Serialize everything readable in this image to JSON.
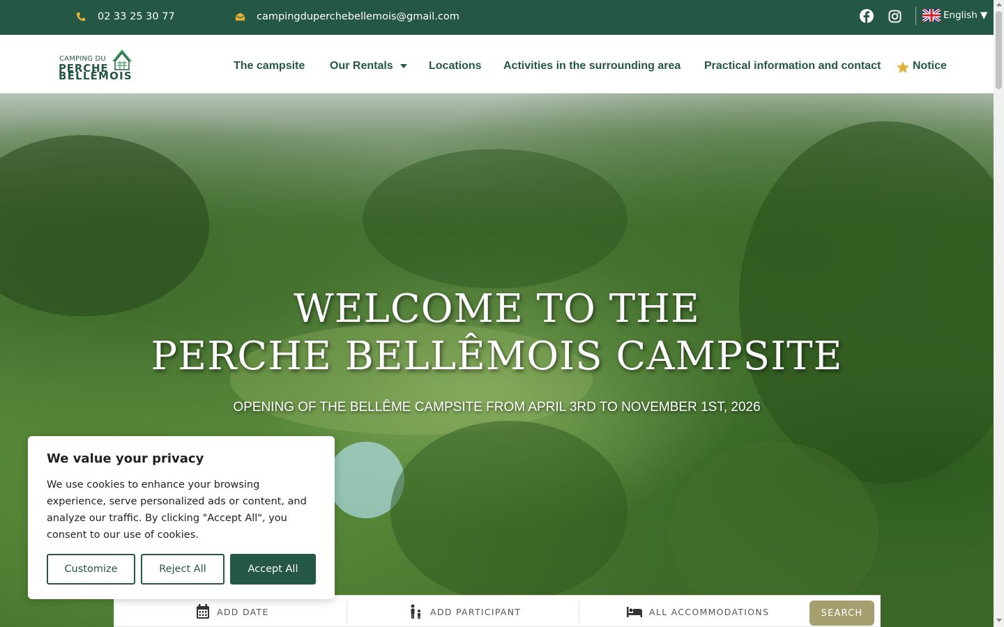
{
  "topbar": {
    "phone": "02 33 25 30 77",
    "email": "campingduperchebellemois@gmail.com",
    "phone_icon": "phone-icon",
    "email_icon": "envelope-icon",
    "social": [
      "facebook-icon",
      "instagram-icon"
    ],
    "language": "English ▼",
    "flag_icon": "uk-flag-icon"
  },
  "logo": {
    "line1": "CAMPING DU",
    "line2": "PERCHE",
    "line3": "BELLÊMOIS"
  },
  "nav": {
    "items": [
      {
        "label": "The campsite"
      },
      {
        "label": "Our Rentals"
      },
      {
        "label": "Locations"
      },
      {
        "label": "Activities in the surrounding area"
      },
      {
        "label": "Practical information and contact"
      },
      {
        "label": "Notice",
        "icon": "star-icon"
      }
    ]
  },
  "hero": {
    "title_line1": "WELCOME TO THE",
    "title_line2": "PERCHE BELLÊMOIS CAMPSITE",
    "subtitle": "OPENING OF THE BELLÊME CAMPSITE FROM APRIL 3RD TO NOVEMBER 1ST, 2026"
  },
  "booking": {
    "date_label": "ADD DATE",
    "participant_label": "ADD PARTICIPANT",
    "accommodation_label": "ALL ACCOMMODATIONS",
    "search_label": "SEARCH"
  },
  "cookie": {
    "title": "We value your privacy",
    "text": "We use cookies to enhance your browsing experience, serve personalized ads or content, and analyze our traffic. By clicking \"Accept All\", you consent to our use of cookies.",
    "customize": "Customize",
    "reject": "Reject All",
    "accept": "Accept All"
  },
  "colors": {
    "brand_green": "#245744",
    "accent_gold": "#e0b03a",
    "search_olive": "#a59e6e"
  }
}
